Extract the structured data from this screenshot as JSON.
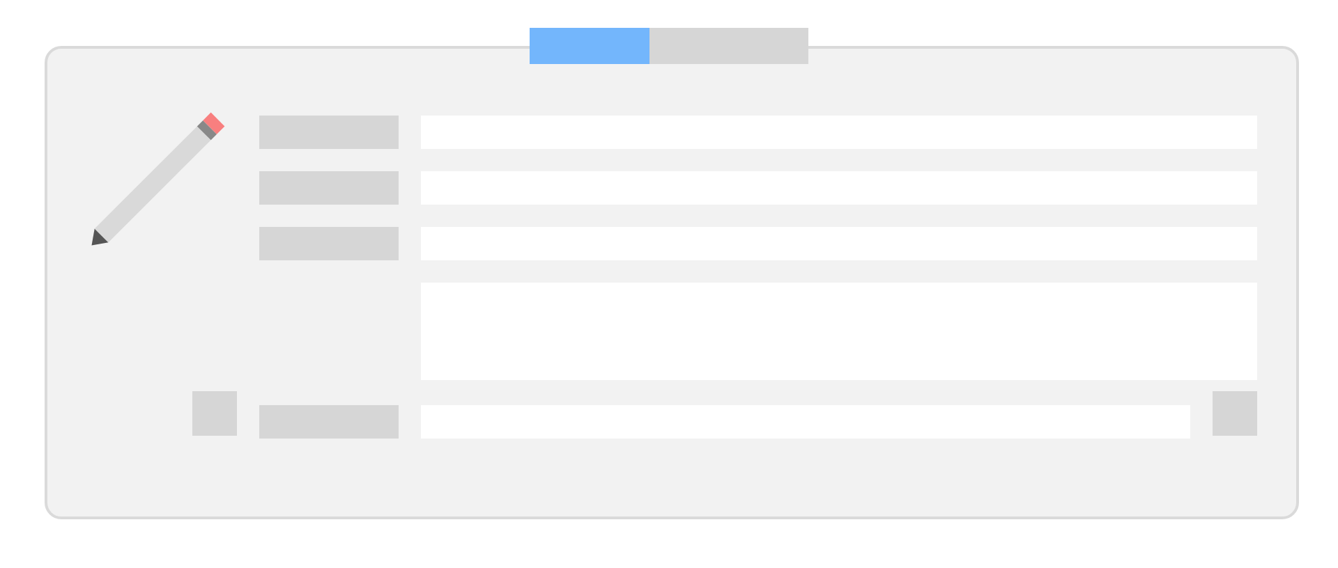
{
  "tabs": [
    {
      "selected": true
    },
    {
      "selected": false
    }
  ],
  "rows": [
    {
      "kind": "field"
    },
    {
      "kind": "field"
    },
    {
      "kind": "field"
    },
    {
      "kind": "textarea"
    },
    {
      "kind": "footer"
    }
  ]
}
